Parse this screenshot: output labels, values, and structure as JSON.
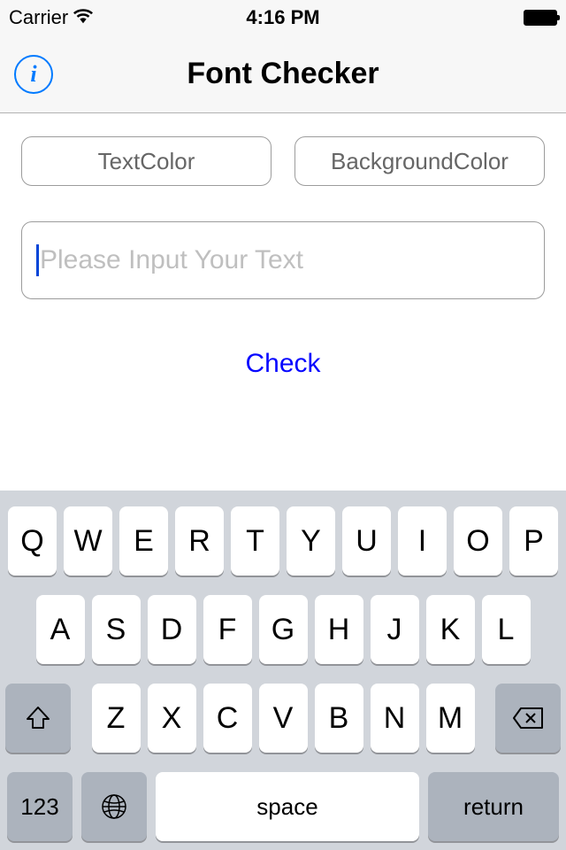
{
  "status": {
    "carrier": "Carrier",
    "time": "4:16 PM"
  },
  "nav": {
    "title": "Font Checker",
    "info_label": "i"
  },
  "buttons": {
    "text_color": "TextColor",
    "bg_color": "BackgroundColor",
    "check": "Check"
  },
  "input": {
    "placeholder": "Please Input Your Text",
    "value": ""
  },
  "keyboard": {
    "row1": [
      "Q",
      "W",
      "E",
      "R",
      "T",
      "Y",
      "U",
      "I",
      "O",
      "P"
    ],
    "row2": [
      "A",
      "S",
      "D",
      "F",
      "G",
      "H",
      "J",
      "K",
      "L"
    ],
    "row3": [
      "Z",
      "X",
      "C",
      "V",
      "B",
      "N",
      "M"
    ],
    "numbers": "123",
    "space": "space",
    "return": "return"
  }
}
